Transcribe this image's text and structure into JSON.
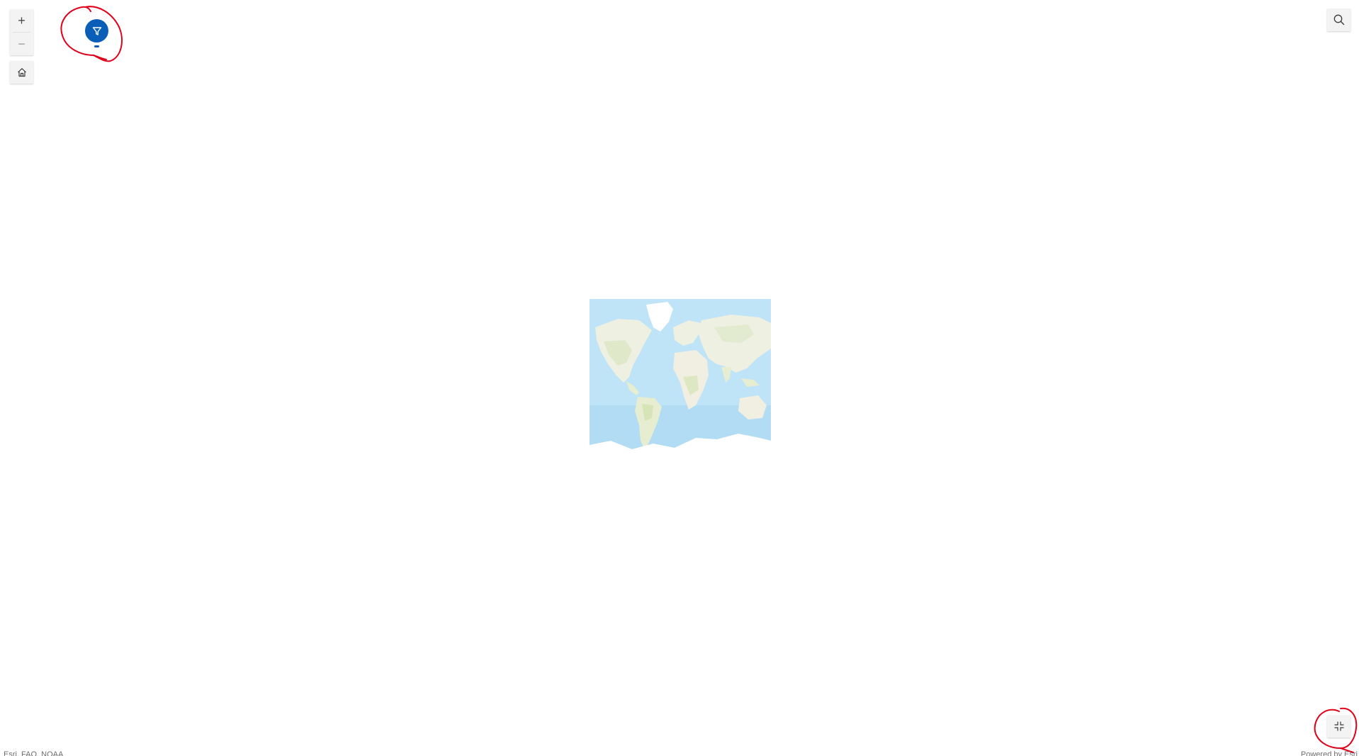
{
  "map": {
    "controls": {
      "zoom_in_symbol": "+",
      "zoom_out_symbol": "−",
      "home_icon": "home-icon",
      "search_icon": "search-icon",
      "filter_icon": "filter-icon",
      "exit_fullscreen_icon": "exit-fullscreen-icon"
    },
    "attribution": {
      "sources": "Esri, FAO, NOAA",
      "powered_by": "Powered by Esri"
    }
  },
  "colors": {
    "filter_button": "#0b5eb8",
    "annotation": "#e0001a",
    "ocean": "#bfe3f7",
    "land": "#f4f4ee"
  }
}
